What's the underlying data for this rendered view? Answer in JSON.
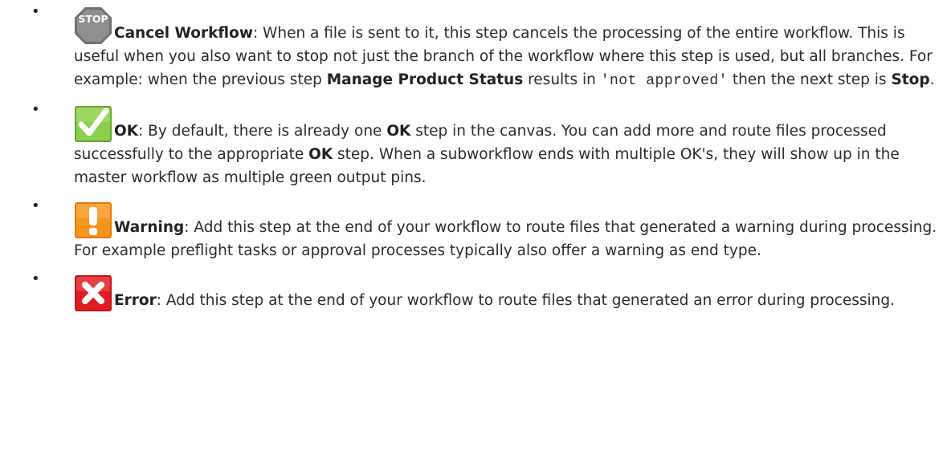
{
  "steps": [
    {
      "id": "cancel",
      "icon": "stop-sign-icon",
      "icon_label": "STOP",
      "title": "Cancel Workflow",
      "text_1": ": When a file is sent to it, this step cancels the processing of the entire workflow. This is useful when you also want to stop not just the branch of the workflow where this step is used, but all branches. For example: when the previous step ",
      "bold_1": "Manage Product Status",
      "text_2": " results in ",
      "code": "'not approved'",
      "text_3": " then the next step is ",
      "bold_2": "Stop",
      "text_4": "."
    },
    {
      "id": "ok",
      "icon": "green-checkmark-icon",
      "title": "OK",
      "text_1": ": By default, there is already one ",
      "bold_1": "OK",
      "text_2": " step in the canvas. You can add more and route files processed successfully to the appropriate ",
      "bold_2": "OK",
      "text_3": " step. When a subworkflow ends with multiple OK's, they will show up in the master workflow as multiple green output pins."
    },
    {
      "id": "warning",
      "icon": "orange-exclamation-icon",
      "title": "Warning",
      "text_1": ": Add this step at the end of your workflow to route files that generated a warning during processing. For example preflight tasks or approval processes typically also offer a warning as end type."
    },
    {
      "id": "error",
      "icon": "red-x-icon",
      "title": "Error",
      "text_1": ": Add this step at the end of your workflow to route files that generated an error during processing."
    }
  ],
  "bullet_char": "•",
  "colors": {
    "stop": "#8c8c8c",
    "ok": "#7cc242",
    "warning": "#f7941d",
    "error": "#e11b22"
  }
}
